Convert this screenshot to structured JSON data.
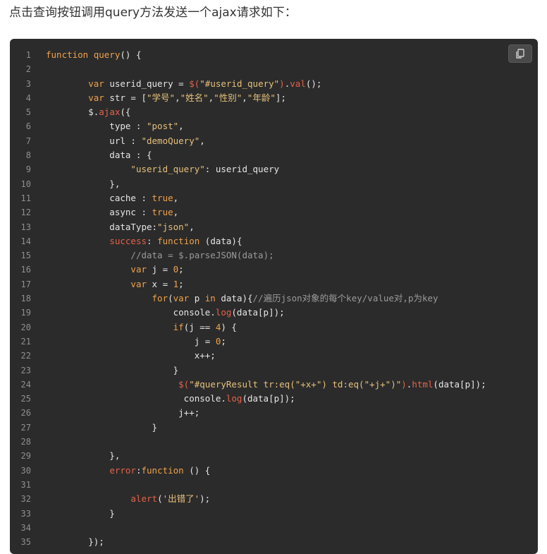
{
  "intro_text": "点击查询按钮调用query方法发送一个ajax请求如下：",
  "copy_button": {
    "icon": "copy-icon"
  },
  "code_lines": [
    {
      "n": "1",
      "tokens": [
        [
          "kw",
          "function "
        ],
        [
          "fn",
          "query"
        ],
        [
          "p",
          "() {"
        ]
      ]
    },
    {
      "n": "2",
      "tokens": []
    },
    {
      "n": "3",
      "tokens": [
        [
          "p",
          "        "
        ],
        [
          "kw",
          "var"
        ],
        [
          "p",
          " userid_query = "
        ],
        [
          "red",
          "$("
        ],
        [
          "str",
          "\"#userid_query\""
        ],
        [
          "red",
          ")"
        ],
        [
          "p",
          "."
        ],
        [
          "red",
          "val"
        ],
        [
          "p",
          "();"
        ]
      ]
    },
    {
      "n": "4",
      "tokens": [
        [
          "p",
          "        "
        ],
        [
          "kw",
          "var"
        ],
        [
          "p",
          " str = ["
        ],
        [
          "str",
          "\"学号\""
        ],
        [
          "p",
          ","
        ],
        [
          "str",
          "\"姓名\""
        ],
        [
          "p",
          ","
        ],
        [
          "str",
          "\"性别\""
        ],
        [
          "p",
          ","
        ],
        [
          "str",
          "\"年龄\""
        ],
        [
          "p",
          "];"
        ]
      ]
    },
    {
      "n": "5",
      "tokens": [
        [
          "p",
          "        $."
        ],
        [
          "red",
          "ajax"
        ],
        [
          "p",
          "({"
        ]
      ]
    },
    {
      "n": "6",
      "tokens": [
        [
          "p",
          "            type : "
        ],
        [
          "str",
          "\"post\""
        ],
        [
          "p",
          ","
        ]
      ]
    },
    {
      "n": "7",
      "tokens": [
        [
          "p",
          "            url : "
        ],
        [
          "str",
          "\"demoQuery\""
        ],
        [
          "p",
          ","
        ]
      ]
    },
    {
      "n": "8",
      "tokens": [
        [
          "p",
          "            data : {"
        ]
      ]
    },
    {
      "n": "9",
      "tokens": [
        [
          "p",
          "                "
        ],
        [
          "str",
          "\"userid_query\""
        ],
        [
          "p",
          ": userid_query"
        ]
      ]
    },
    {
      "n": "10",
      "tokens": [
        [
          "p",
          "            },"
        ]
      ]
    },
    {
      "n": "11",
      "tokens": [
        [
          "p",
          "            cache : "
        ],
        [
          "num",
          "true"
        ],
        [
          "p",
          ","
        ]
      ]
    },
    {
      "n": "12",
      "tokens": [
        [
          "p",
          "            async : "
        ],
        [
          "num",
          "true"
        ],
        [
          "p",
          ","
        ]
      ]
    },
    {
      "n": "13",
      "tokens": [
        [
          "p",
          "            dataType:"
        ],
        [
          "str",
          "\"json\""
        ],
        [
          "p",
          ","
        ]
      ]
    },
    {
      "n": "14",
      "tokens": [
        [
          "p",
          "            "
        ],
        [
          "red",
          "success"
        ],
        [
          "p",
          ": "
        ],
        [
          "kw",
          "function"
        ],
        [
          "p",
          " (data){"
        ]
      ]
    },
    {
      "n": "15",
      "tokens": [
        [
          "p",
          "                "
        ],
        [
          "cm",
          "//data = $.parseJSON(data);"
        ]
      ]
    },
    {
      "n": "16",
      "tokens": [
        [
          "p",
          "                "
        ],
        [
          "kw",
          "var"
        ],
        [
          "p",
          " j = "
        ],
        [
          "num",
          "0"
        ],
        [
          "p",
          ";"
        ]
      ]
    },
    {
      "n": "17",
      "tokens": [
        [
          "p",
          "                "
        ],
        [
          "kw",
          "var"
        ],
        [
          "p",
          " x = "
        ],
        [
          "num",
          "1"
        ],
        [
          "p",
          ";"
        ]
      ]
    },
    {
      "n": "18",
      "tokens": [
        [
          "p",
          "                    "
        ],
        [
          "kw",
          "for"
        ],
        [
          "p",
          "("
        ],
        [
          "kw",
          "var"
        ],
        [
          "p",
          " p "
        ],
        [
          "kw",
          "in"
        ],
        [
          "p",
          " data){"
        ],
        [
          "cm",
          "//遍历json对象的每个key/value对,p为key"
        ]
      ]
    },
    {
      "n": "19",
      "tokens": [
        [
          "p",
          "                        console."
        ],
        [
          "red",
          "log"
        ],
        [
          "p",
          "(data[p]);"
        ]
      ]
    },
    {
      "n": "20",
      "tokens": [
        [
          "p",
          "                        "
        ],
        [
          "kw",
          "if"
        ],
        [
          "p",
          "(j == "
        ],
        [
          "num",
          "4"
        ],
        [
          "p",
          ") {"
        ]
      ]
    },
    {
      "n": "21",
      "tokens": [
        [
          "p",
          "                            j = "
        ],
        [
          "num",
          "0"
        ],
        [
          "p",
          ";"
        ]
      ]
    },
    {
      "n": "22",
      "tokens": [
        [
          "p",
          "                            x++;"
        ]
      ]
    },
    {
      "n": "23",
      "tokens": [
        [
          "p",
          "                        }"
        ]
      ]
    },
    {
      "n": "24",
      "tokens": [
        [
          "p",
          "                         "
        ],
        [
          "red",
          "$("
        ],
        [
          "str",
          "\"#queryResult tr:eq(\"+x+\") td:eq(\"+j+\")\""
        ],
        [
          "red",
          ")"
        ],
        [
          "p",
          "."
        ],
        [
          "red",
          "html"
        ],
        [
          "p",
          "(data[p]);"
        ]
      ]
    },
    {
      "n": "25",
      "tokens": [
        [
          "p",
          "                          console."
        ],
        [
          "red",
          "log"
        ],
        [
          "p",
          "(data[p]);"
        ]
      ]
    },
    {
      "n": "26",
      "tokens": [
        [
          "p",
          "                         j++;"
        ]
      ]
    },
    {
      "n": "27",
      "tokens": [
        [
          "p",
          "                    }"
        ]
      ]
    },
    {
      "n": "28",
      "tokens": []
    },
    {
      "n": "29",
      "tokens": [
        [
          "p",
          "            },"
        ]
      ]
    },
    {
      "n": "30",
      "tokens": [
        [
          "p",
          "            "
        ],
        [
          "red",
          "error"
        ],
        [
          "p",
          ":"
        ],
        [
          "kw",
          "function"
        ],
        [
          "p",
          " () {"
        ]
      ]
    },
    {
      "n": "31",
      "tokens": []
    },
    {
      "n": "32",
      "tokens": [
        [
          "p",
          "                "
        ],
        [
          "red",
          "alert"
        ],
        [
          "p",
          "("
        ],
        [
          "str",
          "'出错了'"
        ],
        [
          "p",
          ");"
        ]
      ]
    },
    {
      "n": "33",
      "tokens": [
        [
          "p",
          "            }"
        ]
      ]
    },
    {
      "n": "34",
      "tokens": []
    },
    {
      "n": "35",
      "tokens": [
        [
          "p",
          "        });"
        ]
      ]
    }
  ]
}
